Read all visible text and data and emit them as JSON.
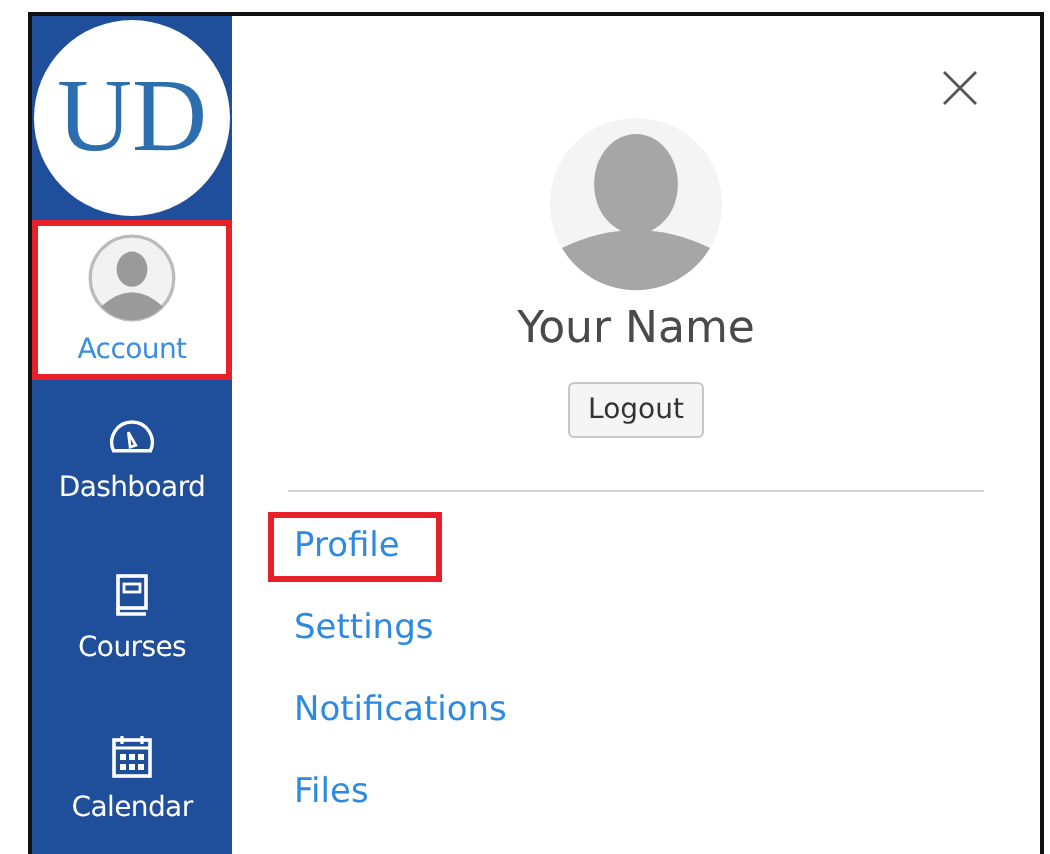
{
  "logo": {
    "text": "UD"
  },
  "sidebar": {
    "items": [
      {
        "label": "Account",
        "kind": "account",
        "selected": true,
        "highlighted": true
      },
      {
        "label": "Dashboard",
        "kind": "dashboard",
        "selected": false,
        "highlighted": false
      },
      {
        "label": "Courses",
        "kind": "courses",
        "selected": false,
        "highlighted": false
      },
      {
        "label": "Calendar",
        "kind": "calendar",
        "selected": false,
        "highlighted": false
      }
    ]
  },
  "panel": {
    "name": "Your Name",
    "logout": "Logout",
    "links": [
      {
        "label": "Profile",
        "highlighted": true
      },
      {
        "label": "Settings",
        "highlighted": false
      },
      {
        "label": "Notifications",
        "highlighted": false
      },
      {
        "label": "Files",
        "highlighted": false
      }
    ]
  }
}
